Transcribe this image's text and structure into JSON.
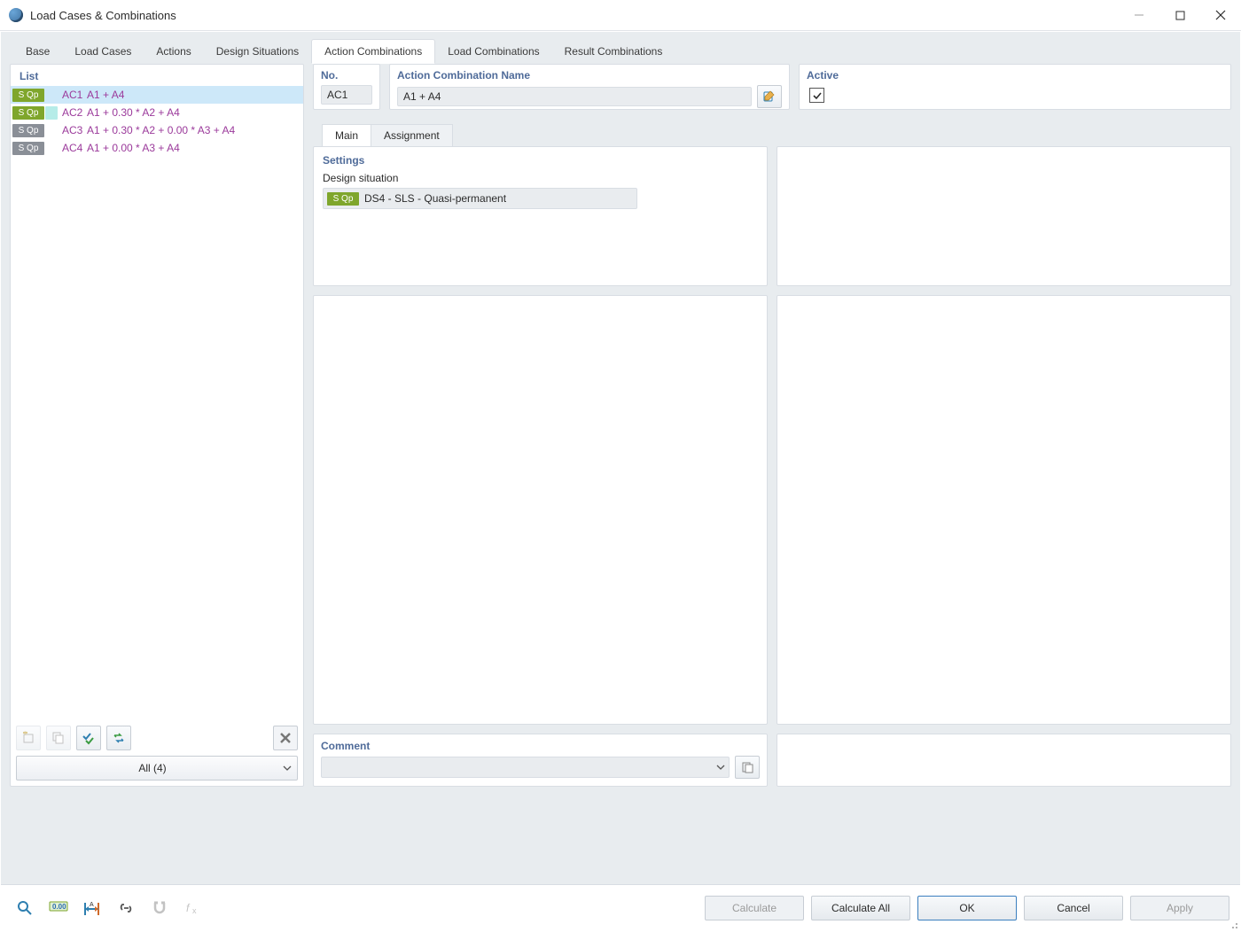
{
  "window": {
    "title": "Load Cases & Combinations"
  },
  "tabs": {
    "items": [
      "Base",
      "Load Cases",
      "Actions",
      "Design Situations",
      "Action Combinations",
      "Load Combinations",
      "Result Combinations"
    ],
    "activeIndex": 4
  },
  "list": {
    "heading": "List",
    "rows": [
      {
        "badge": "S Qp",
        "badgeStyle": "green",
        "swatch": "blue",
        "id": "AC1",
        "name": "A1 + A4",
        "selected": true
      },
      {
        "badge": "S Qp",
        "badgeStyle": "green",
        "swatch": "teal",
        "id": "AC2",
        "name": "A1 + 0.30 * A2 + A4",
        "selected": false
      },
      {
        "badge": "S Qp",
        "badgeStyle": "grey",
        "swatch": "none",
        "id": "AC3",
        "name": "A1 + 0.30 * A2 + 0.00 * A3 + A4",
        "selected": false
      },
      {
        "badge": "S Qp",
        "badgeStyle": "grey",
        "swatch": "none",
        "id": "AC4",
        "name": "A1 + 0.00 * A3 + A4",
        "selected": false
      }
    ],
    "filter": "All (4)"
  },
  "details": {
    "noLabel": "No.",
    "no": "AC1",
    "nameLabel": "Action Combination Name",
    "name": "A1 + A4",
    "activeLabel": "Active",
    "active": true
  },
  "subtabs": {
    "items": [
      "Main",
      "Assignment"
    ],
    "activeIndex": 0
  },
  "settings": {
    "heading": "Settings",
    "dsLabel": "Design situation",
    "dsBadge": "S Qp",
    "dsValue": "DS4 - SLS - Quasi-permanent"
  },
  "comment": {
    "heading": "Comment",
    "value": ""
  },
  "footer": {
    "calculate": "Calculate",
    "calculateAll": "Calculate All",
    "ok": "OK",
    "cancel": "Cancel",
    "apply": "Apply"
  },
  "icons": {
    "search": "search-icon",
    "units": "units-icon",
    "dimension": "dimension-icon",
    "link": "link-icon",
    "magnet": "magnet-icon",
    "fx": "fx-icon",
    "new": "new-icon",
    "copy": "copy-icon",
    "checkall": "check-all-icon",
    "swap": "swap-icon",
    "delete": "delete-icon",
    "pencil": "pencil-icon",
    "paste": "paste-icon",
    "minimize": "minimize-icon",
    "maximize": "maximize-icon",
    "close": "close-icon"
  }
}
